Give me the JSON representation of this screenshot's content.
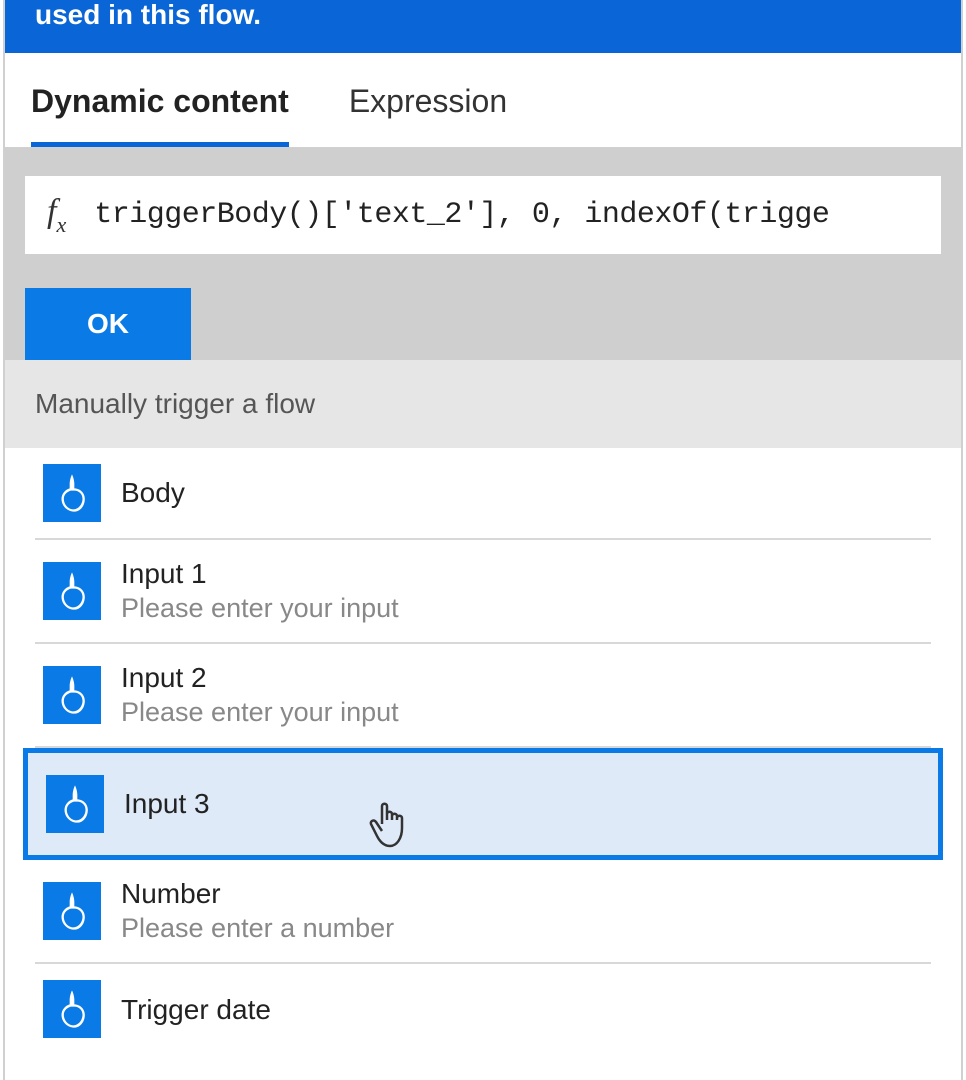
{
  "header": {
    "text": "used in this flow."
  },
  "tabs": {
    "dynamic": "Dynamic content",
    "expression": "Expression"
  },
  "expression": {
    "fx_label": "fx",
    "value": "triggerBody()['text_2'], 0, indexOf(trigge",
    "ok": "OK"
  },
  "section": {
    "title": "Manually trigger a flow"
  },
  "items": [
    {
      "label": "Body",
      "desc": ""
    },
    {
      "label": "Input 1",
      "desc": "Please enter your input"
    },
    {
      "label": "Input 2",
      "desc": "Please enter your input"
    },
    {
      "label": "Input 3",
      "desc": "",
      "highlighted": true
    },
    {
      "label": "Number",
      "desc": "Please enter a number"
    },
    {
      "label": "Trigger date",
      "desc": ""
    }
  ]
}
